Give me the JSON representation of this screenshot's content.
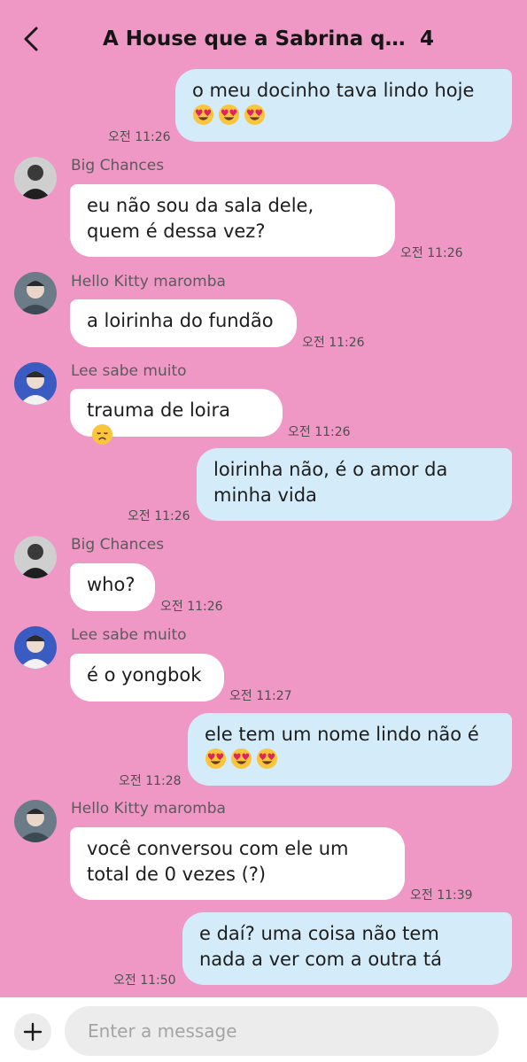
{
  "header": {
    "title": "A House que a Sabrina qu...",
    "member_count": "4"
  },
  "colors": {
    "background": "#ef97c5",
    "incoming_bubble": "#ffffff",
    "outgoing_bubble": "#d4ecfa"
  },
  "messages": [
    {
      "direction": "out",
      "lines": [
        "o meu docinho tava lindo hoje"
      ],
      "emoji_line": [
        "heart-eyes-emoji",
        "heart-eyes-emoji",
        "heart-eyes-emoji"
      ],
      "time": "오전 11:26"
    },
    {
      "direction": "in",
      "sender": "Big Chances",
      "avatar": "big-chances-avatar",
      "lines": [
        "eu não sou da sala dele,",
        "quem é dessa vez?"
      ],
      "time": "오전 11:26"
    },
    {
      "direction": "in",
      "sender": "Hello Kitty maromba",
      "avatar": "hello-kitty-maromba-avatar",
      "lines": [
        "a loirinha do fundão"
      ],
      "time": "오전 11:26"
    },
    {
      "direction": "in",
      "sender": "Lee sabe muito",
      "avatar": "lee-sabe-muito-avatar",
      "lines": [
        "trauma de loira"
      ],
      "trailing_emoji": "disappointed-emoji",
      "time": "오전 11:26"
    },
    {
      "direction": "out",
      "lines": [
        "loirinha não, é o amor da",
        "minha vida"
      ],
      "time": "오전 11:26"
    },
    {
      "direction": "in",
      "sender": "Big Chances",
      "avatar": "big-chances-avatar",
      "lines": [
        "who?"
      ],
      "time": "오전 11:26"
    },
    {
      "direction": "in",
      "sender": "Lee sabe muito",
      "avatar": "lee-sabe-muito-avatar",
      "lines": [
        "é o yongbok"
      ],
      "time": "오전 11:27"
    },
    {
      "direction": "out",
      "lines": [
        "ele tem um nome lindo não é"
      ],
      "emoji_line": [
        "heart-eyes-emoji",
        "heart-eyes-emoji",
        "heart-eyes-emoji"
      ],
      "time": "오전 11:28"
    },
    {
      "direction": "in",
      "sender": "Hello Kitty maromba",
      "avatar": "hello-kitty-maromba-avatar",
      "lines": [
        "você conversou com ele um",
        "total de 0 vezes (?)"
      ],
      "time": "오전 11:39"
    },
    {
      "direction": "out",
      "lines": [
        "e daí? uma coisa não tem",
        "nada a ver com a outra tá"
      ],
      "time": "오전 11:50"
    }
  ],
  "composer": {
    "add_icon": "plus-icon",
    "placeholder": "Enter a message"
  }
}
